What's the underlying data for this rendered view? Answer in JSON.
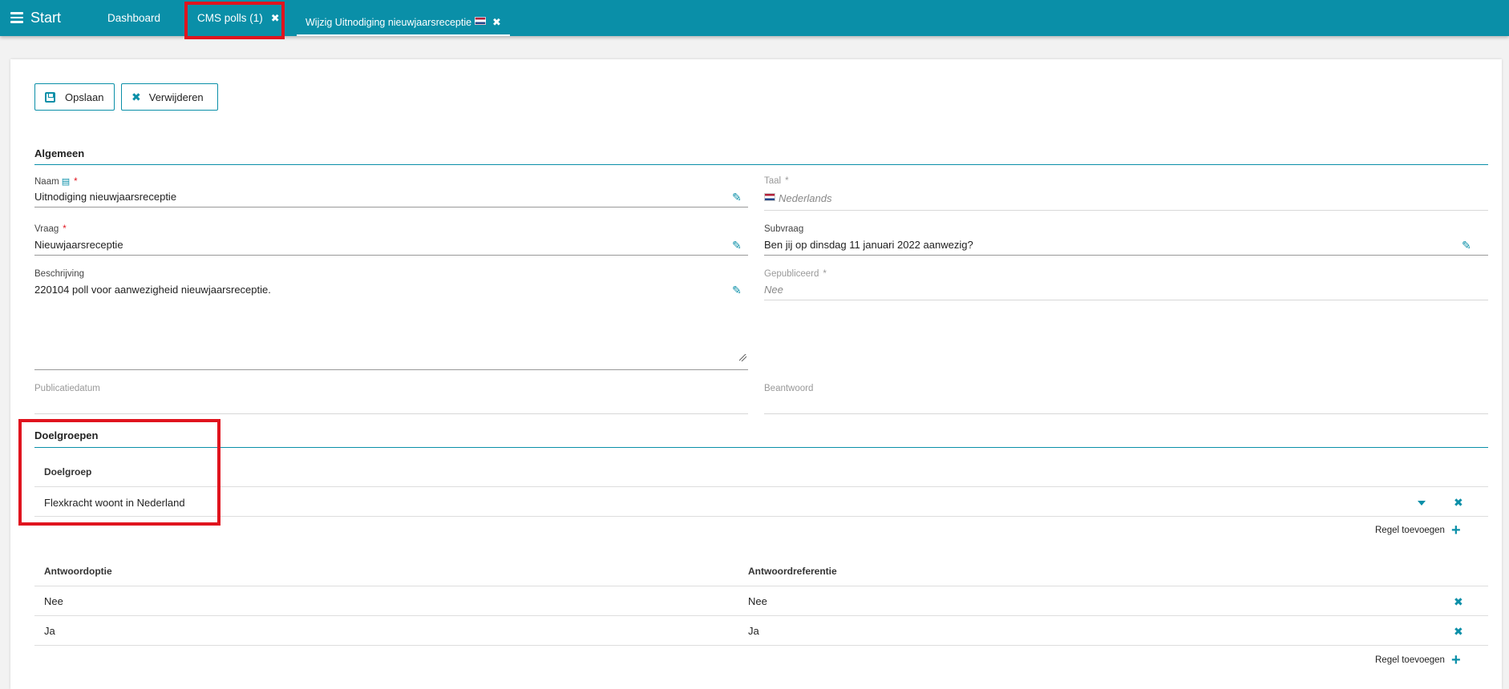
{
  "topbar": {
    "start_label": "Start",
    "tabs": [
      {
        "label": "Dashboard"
      },
      {
        "label": "CMS polls (1)",
        "close": "✖"
      },
      {
        "label": "Wijzig Uitnodiging nieuwjaarsreceptie",
        "close": "✖"
      }
    ]
  },
  "toolbar": {
    "save_label": "Opslaan",
    "delete_label": "Verwijderen"
  },
  "algemeen": {
    "title": "Algemeen",
    "naam": {
      "label": "Naam",
      "value": "Uitnodiging nieuwjaarsreceptie",
      "required": "*"
    },
    "taal": {
      "label": "Taal",
      "value": "Nederlands",
      "required": "*"
    },
    "vraag": {
      "label": "Vraag",
      "value": "Nieuwjaarsreceptie",
      "required": "*"
    },
    "subvraag": {
      "label": "Subvraag",
      "value": "Ben jij op dinsdag 11 januari 2022 aanwezig?"
    },
    "beschrijving": {
      "label": "Beschrijving",
      "value": "220104 poll voor aanwezigheid nieuwjaarsreceptie."
    },
    "gepubliceerd": {
      "label": "Gepubliceerd",
      "value": "Nee",
      "required": "*"
    },
    "publicatiedatum": {
      "label": "Publicatiedatum",
      "value": ""
    },
    "beantwoord": {
      "label": "Beantwoord",
      "value": ""
    }
  },
  "doelgroepen": {
    "title": "Doelgroepen",
    "column": "Doelgroep",
    "rows": [
      "Flexkracht woont in Nederland"
    ],
    "add_label": "Regel toevoegen"
  },
  "antwoorden": {
    "columns": [
      "Antwoordoptie",
      "Antwoordreferentie"
    ],
    "rows": [
      {
        "optie": "Nee",
        "referentie": "Nee"
      },
      {
        "optie": "Ja",
        "referentie": "Ja"
      }
    ],
    "add_label": "Regel toevoegen"
  },
  "colors": {
    "accent": "#0a8fa8",
    "highlight": "#e0141e"
  }
}
